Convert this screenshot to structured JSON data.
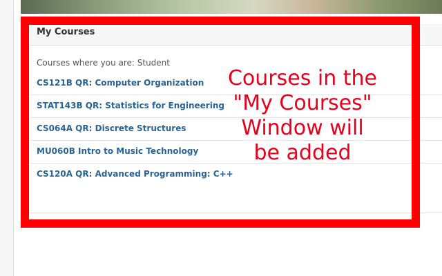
{
  "block": {
    "title": "My Courses",
    "role_line": "Courses where you are: Student",
    "courses": [
      "CS121B QR: Computer Organization",
      "STAT143B QR: Statistics for Engineering",
      "CS064A QR: Discrete Structures",
      "MU060B Intro to Music Technology",
      "CS120A QR: Advanced Programming: C++"
    ]
  },
  "annotation": {
    "lines": [
      "Courses in the",
      "\"My Courses\"",
      "Window will",
      "be added"
    ]
  },
  "colors": {
    "highlight": "#ff0000",
    "annotation_text": "#e8001c",
    "link": "#2a6496"
  }
}
